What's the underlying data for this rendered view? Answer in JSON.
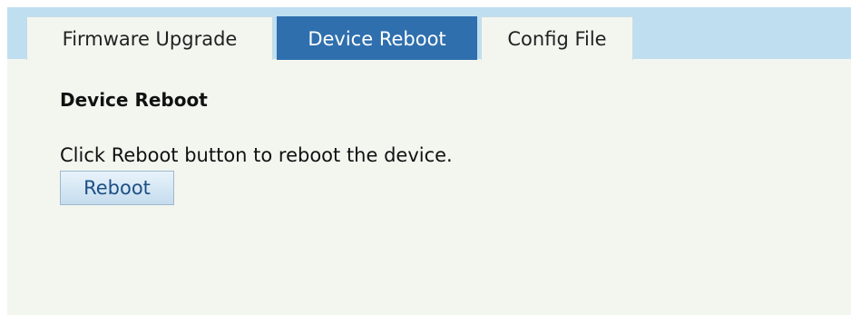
{
  "tabs": [
    {
      "label": "Firmware Upgrade",
      "active": false
    },
    {
      "label": "Device Reboot",
      "active": true
    },
    {
      "label": "Config File",
      "active": false
    }
  ],
  "section": {
    "title": "Device Reboot",
    "description": "Click Reboot button to reboot the device.",
    "reboot_label": "Reboot"
  },
  "colors": {
    "tabbar_bg": "#bfdff0",
    "active_tab_bg": "#2f6fae",
    "content_bg": "#f3f6ef"
  }
}
